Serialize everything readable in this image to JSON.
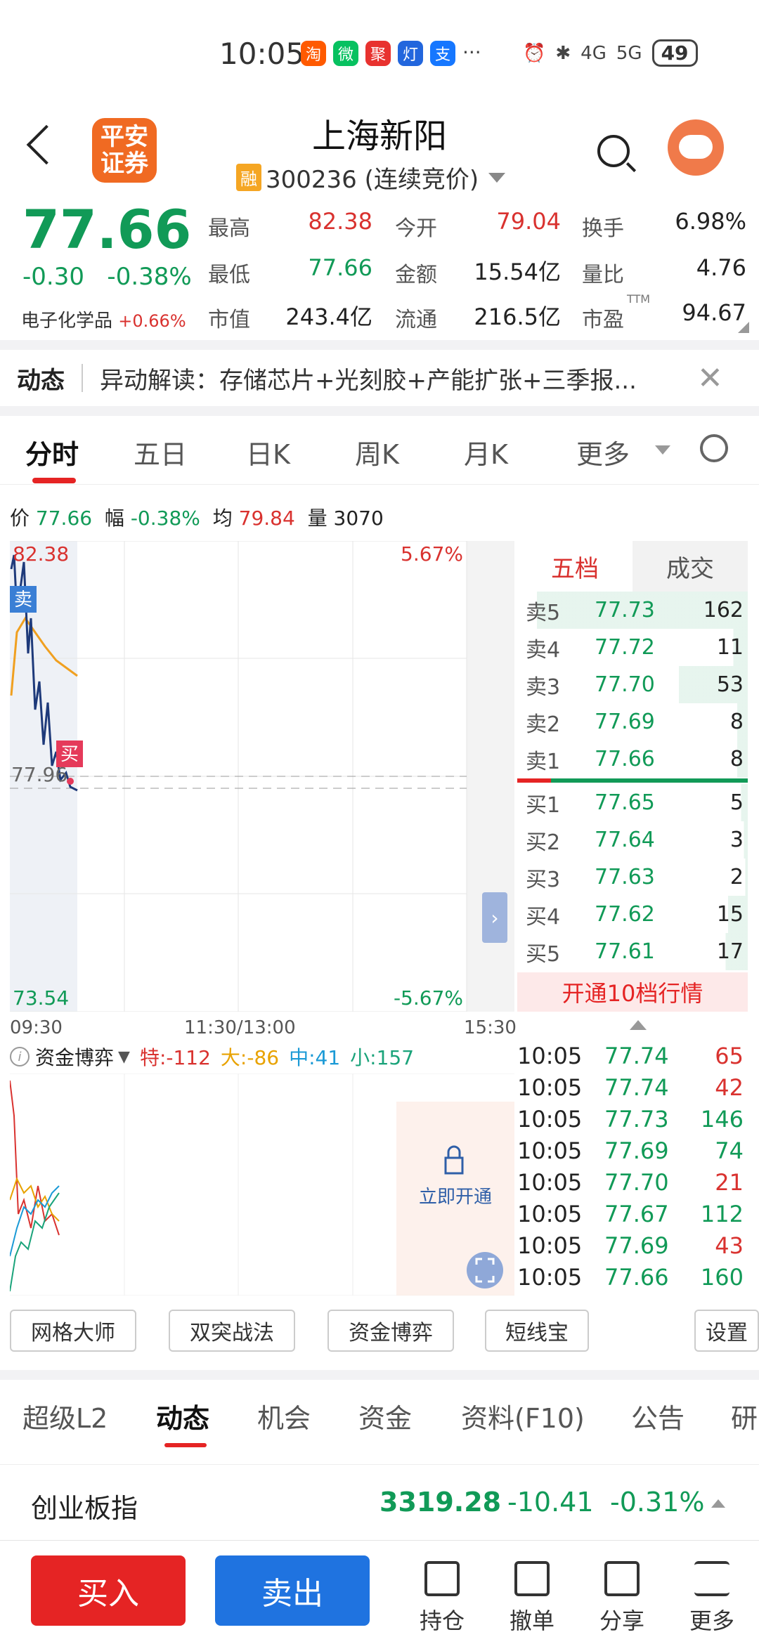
{
  "status": {
    "time": "10:05",
    "apps": [
      "淘",
      "微",
      "聚",
      "灯",
      "支"
    ],
    "more": "···",
    "net1": "4G",
    "net2": "5G",
    "battery": "49"
  },
  "header": {
    "title": "上海新阳",
    "badge": "融",
    "code": "300236 (连续竞价)",
    "logo_text": "平安证券"
  },
  "quote": {
    "price": "77.66",
    "change": "-0.30",
    "change_pct": "-0.38%",
    "sector": "电子化学品",
    "sector_chg": "+0.66%",
    "fields": [
      {
        "label": "最高",
        "value": "82.38",
        "color": "r"
      },
      {
        "label": "今开",
        "value": "79.04",
        "color": "r"
      },
      {
        "label": "换手",
        "value": "6.98%",
        "color": "k"
      },
      {
        "label": "最低",
        "value": "77.66",
        "color": "g"
      },
      {
        "label": "金额",
        "value": "15.54亿",
        "color": "k"
      },
      {
        "label": "量比",
        "value": "4.76",
        "color": "k"
      },
      {
        "label": "市值",
        "value": "243.4亿",
        "color": "k"
      },
      {
        "label": "流通",
        "value": "216.5亿",
        "color": "k"
      },
      {
        "label": "市盈",
        "value": "94.67",
        "color": "k"
      }
    ],
    "ttm": "TTM"
  },
  "news": {
    "tag": "动态",
    "text": "异动解读：存储芯片+光刻胶+产能扩张+三季报..."
  },
  "tabs": [
    "分时",
    "五日",
    "日K",
    "周K",
    "月K",
    "更多"
  ],
  "info": {
    "p_label": "价",
    "p": "77.66",
    "f_label": "幅",
    "f": "-0.38%",
    "j_label": "均",
    "j": "79.84",
    "v_label": "量",
    "v": "3070"
  },
  "chart": {
    "high": "82.38",
    "high_pct": "5.67%",
    "low": "73.54",
    "low_pct": "-5.67%",
    "mid": "77.96",
    "sell_tag": "卖",
    "buy_tag": "买",
    "t_start": "09:30",
    "t_mid": "11:30/13:00",
    "t_end": "15:30"
  },
  "orderbook": {
    "tabs": [
      "五档",
      "成交"
    ],
    "asks": [
      [
        "卖5",
        "77.73",
        "162"
      ],
      [
        "卖4",
        "77.72",
        "11"
      ],
      [
        "卖3",
        "77.70",
        "53"
      ],
      [
        "卖2",
        "77.69",
        "8"
      ],
      [
        "卖1",
        "77.66",
        "8"
      ]
    ],
    "bids": [
      [
        "买1",
        "77.65",
        "5"
      ],
      [
        "买2",
        "77.64",
        "3"
      ],
      [
        "买3",
        "77.63",
        "2"
      ],
      [
        "买4",
        "77.62",
        "15"
      ],
      [
        "买5",
        "77.61",
        "17"
      ]
    ],
    "upgrade": "开通10档行情"
  },
  "flow": {
    "title": "资金博弈",
    "te": "特:-112",
    "da": "大:-86",
    "zh": "中:41",
    "xi": "小:157",
    "lock": "立即开通"
  },
  "trades": [
    [
      "10:05",
      "77.74",
      "65",
      "r"
    ],
    [
      "10:05",
      "77.74",
      "42",
      "r"
    ],
    [
      "10:05",
      "77.73",
      "146",
      "g"
    ],
    [
      "10:05",
      "77.69",
      "74",
      "g"
    ],
    [
      "10:05",
      "77.70",
      "21",
      "r"
    ],
    [
      "10:05",
      "77.67",
      "112",
      "g"
    ],
    [
      "10:05",
      "77.69",
      "43",
      "r"
    ],
    [
      "10:05",
      "77.66",
      "160",
      "g"
    ]
  ],
  "tools": [
    "网格大师",
    "双突战法",
    "资金博弈",
    "短线宝",
    "设置"
  ],
  "subtabs": [
    "超级L2",
    "动态",
    "机会",
    "资金",
    "资料(F10)",
    "公告",
    "研"
  ],
  "index": {
    "name": "创业板指",
    "value": "3319.28",
    "chg": "-10.41",
    "pct": "-0.31%"
  },
  "bottom": {
    "buy": "买入",
    "sell": "卖出",
    "items": [
      "持仓",
      "撤单",
      "分享",
      "更多"
    ]
  }
}
